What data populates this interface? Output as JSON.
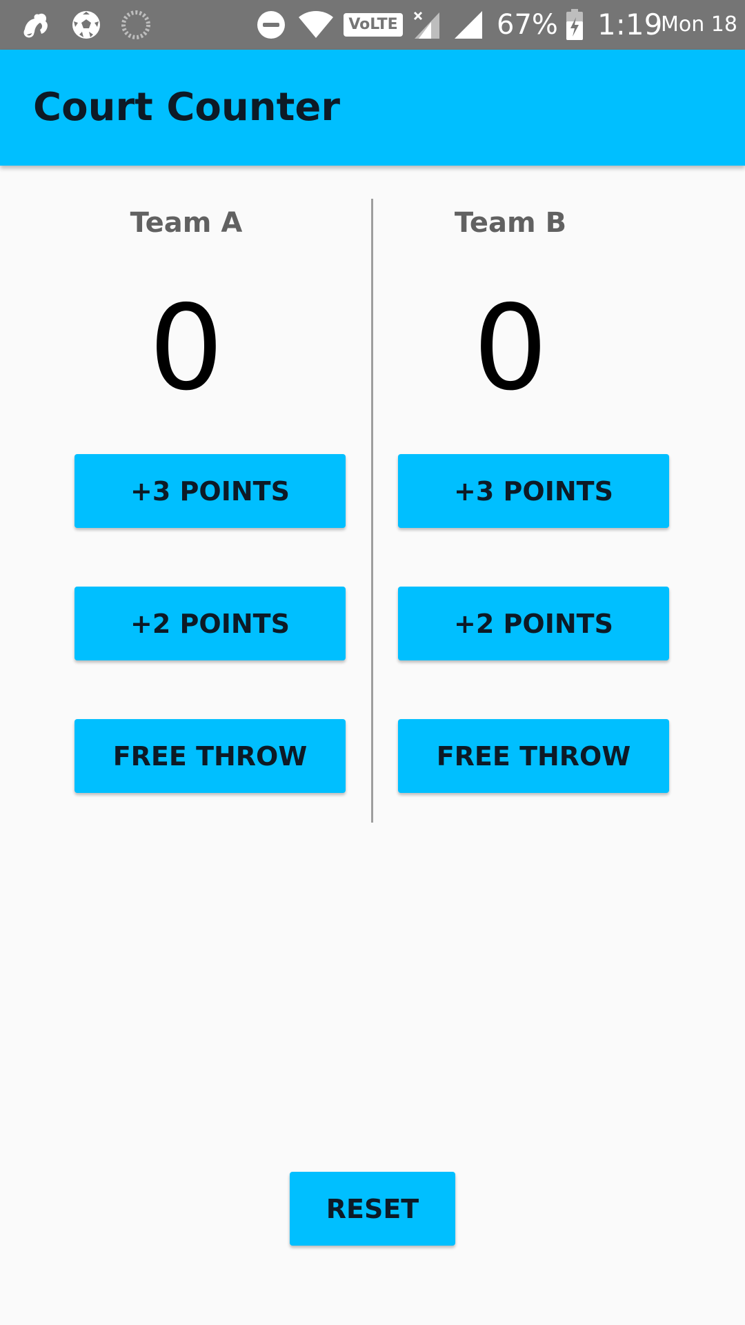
{
  "status_bar": {
    "icons": [
      "uc-browser-icon",
      "soccer-ball-icon",
      "loading-icon",
      "do-not-disturb-icon",
      "wifi-icon",
      "volte-icon",
      "no-signal-icon",
      "signal-icon",
      "battery-charging-icon"
    ],
    "volte_label": "VoLTE",
    "battery_percent": "67%",
    "time": "1:19",
    "date": "Mon 18"
  },
  "app_bar": {
    "title": "Court Counter"
  },
  "team_a": {
    "name": "Team A",
    "score": "0",
    "plus3_label": "+3 POINTS",
    "plus2_label": "+2 POINTS",
    "free_throw_label": "FREE THROW"
  },
  "team_b": {
    "name": "Team B",
    "score": "0",
    "plus3_label": "+3 POINTS",
    "plus2_label": "+2 POINTS",
    "free_throw_label": "FREE THROW"
  },
  "reset_label": "RESET",
  "colors": {
    "accent": "#00bfff",
    "status_bar": "#757575",
    "background": "#fafafa"
  }
}
